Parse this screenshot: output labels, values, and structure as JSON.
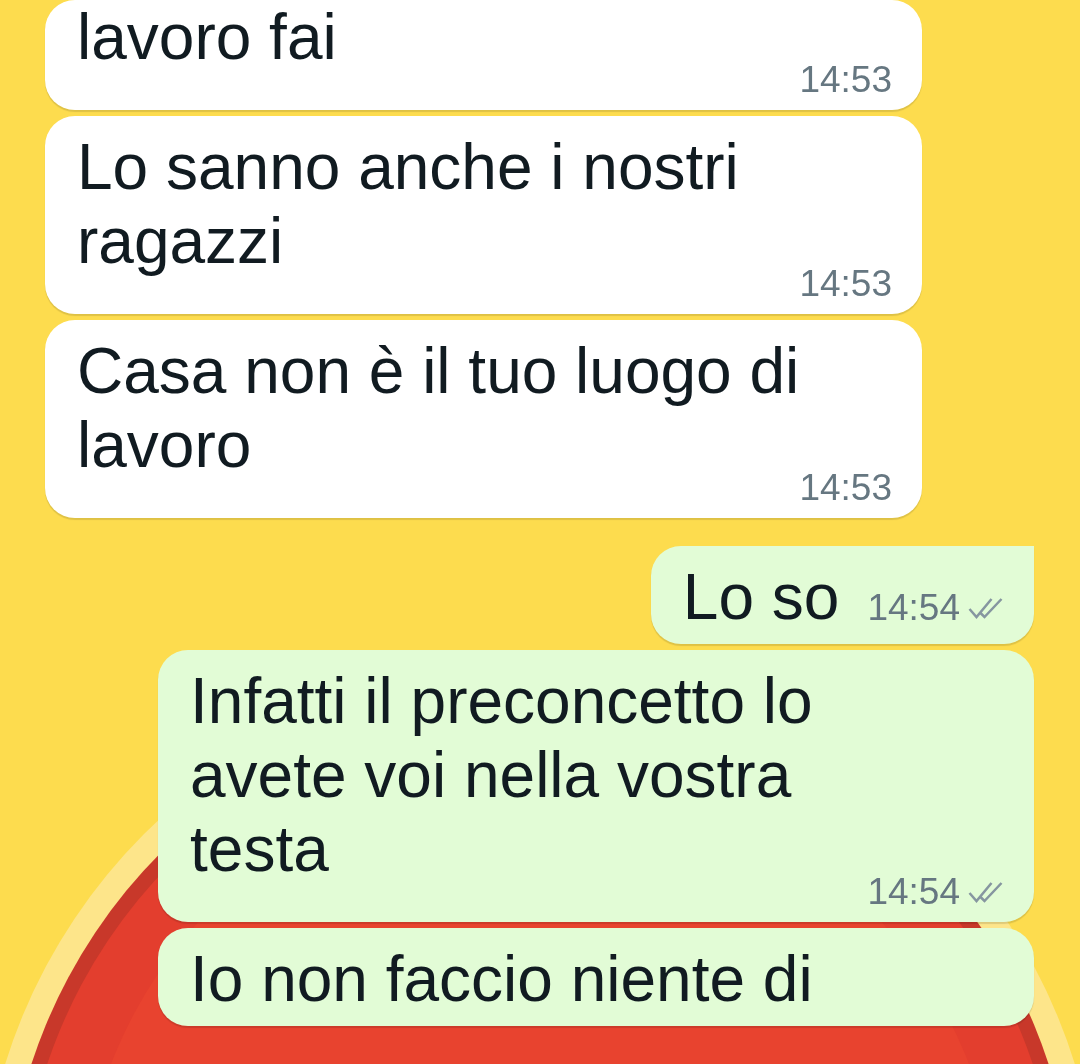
{
  "messages": [
    {
      "kind": "incoming",
      "text": "lavoro fai",
      "time": "14:53"
    },
    {
      "kind": "incoming",
      "text": "Lo sanno anche i nostri ragazzi",
      "time": "14:53"
    },
    {
      "kind": "incoming",
      "text": "Casa non è il tuo luogo di lavoro",
      "time": "14:53"
    },
    {
      "kind": "outgoing",
      "text": "Lo so",
      "time": "14:54",
      "read": false
    },
    {
      "kind": "outgoing",
      "text": "Infatti il preconcetto lo avete voi nella vostra testa",
      "time": "14:54",
      "read": false
    },
    {
      "kind": "outgoing",
      "text": "Io non faccio niente di"
    }
  ]
}
